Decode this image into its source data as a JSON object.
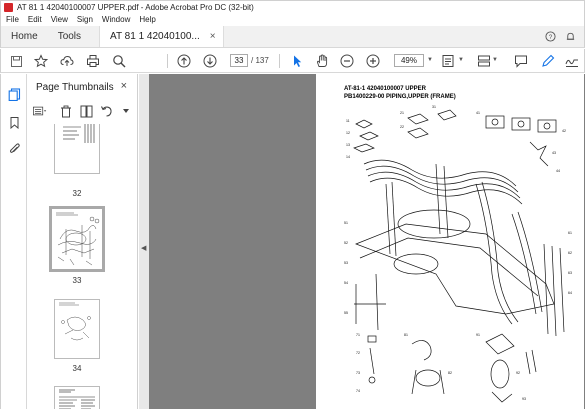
{
  "window": {
    "title": "AT 81 1 42040100007 UPPER.pdf - Adobe Acrobat Pro DC (32-bit)"
  },
  "menu": [
    "File",
    "Edit",
    "View",
    "Sign",
    "Window",
    "Help"
  ],
  "tabs": {
    "home": "Home",
    "tools": "Tools",
    "document": "AT 81 1 42040100...",
    "close_glyph": "×"
  },
  "toolbar": {
    "current_page": "33",
    "page_count": "/ 137",
    "zoom": "49%"
  },
  "thumbnails_panel": {
    "title": "Page Thumbnails",
    "close_glyph": "×",
    "pages": [
      {
        "label": "32"
      },
      {
        "label": "33"
      },
      {
        "label": "34"
      }
    ]
  },
  "page": {
    "title_line1": "AT-81-1 42040100007 UPPER",
    "title_line2": "PB1400229-00 PIPING,UPPER (FRAME)"
  },
  "colors": {
    "acrobat_red": "#d4262a",
    "accent_blue": "#1473e6",
    "doc_background": "#7f7f7f"
  },
  "icons": [
    "save-icon",
    "bookmark-star-icon",
    "upload-icon",
    "print-icon",
    "search-icon",
    "prev-page-icon",
    "next-page-icon",
    "select-arrow-icon",
    "hand-icon",
    "zoom-out-icon",
    "zoom-in-icon",
    "fit-icon",
    "scroll-mode-icon",
    "comment-icon",
    "pen-icon",
    "sign-icon",
    "share-icon"
  ]
}
